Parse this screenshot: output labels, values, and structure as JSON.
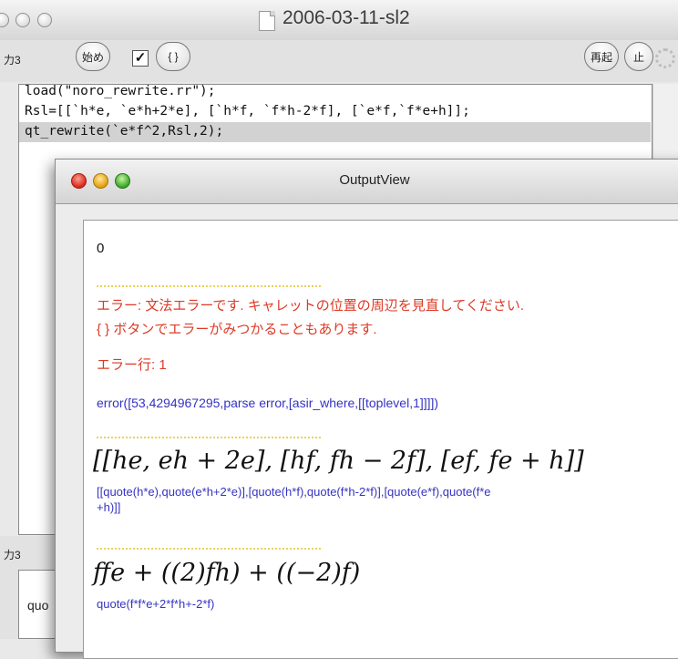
{
  "back_window": {
    "title": "2006-03-11-sl2",
    "toolbar": {
      "input_label": "力3",
      "start_button": "始め",
      "braces_button": "{ }",
      "restart_button": "再起",
      "stop_button": "止"
    },
    "code_lines": [
      "load(\"noro_rewrite.rr\");",
      "Rsl=[[`h*e, `e*h+2*e], [`h*f, `f*h-2*f], [`e*f,`f*e+h]];",
      "qt_rewrite(`e*f^2,Rsl,2);"
    ],
    "lower_label": "力3",
    "lower_text": "quo"
  },
  "output_window": {
    "title": "OutputView",
    "first_output": "0",
    "error_line1": "エラー: 文法エラーです. キャレットの位置の周辺を見直してください.",
    "error_line2": "{ } ボタンでエラーがみつかることもあります.",
    "error_row": "エラー行: 1",
    "error_detail": "error([53,4294967295,parse error,[asir_where,[[toplevel,1]]]])",
    "math1": "[[he, eh + 2e], [hf, fh − 2f], [ef, fe + h]]",
    "quote1_line1": "[[quote(h*e),quote(e*h+2*e)],[quote(h*f),quote(f*h-2*f)],[quote(e*f),quote(f*e",
    "quote1_line2": "+h)]]",
    "math2": "ffe + ((2)fh) + ((−2)f)",
    "quote2": "quote(f*f*e+2*f*h+-2*f)"
  }
}
